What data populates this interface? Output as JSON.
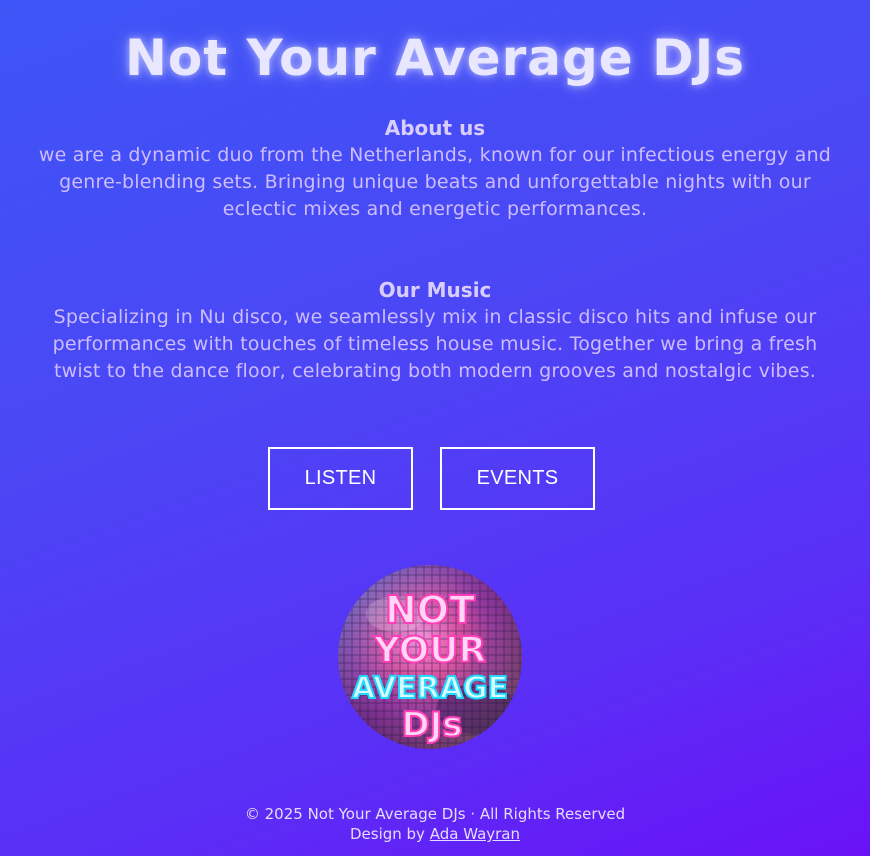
{
  "header": {
    "title": "Not Your Average DJs"
  },
  "about": {
    "heading": "About us",
    "text": "we are a dynamic duo from the Netherlands, known for our infectious energy and genre-blending sets. Bringing unique beats and unforgettable nights with our eclectic mixes and energetic performances."
  },
  "music": {
    "heading": "Our Music",
    "text": "Specializing in Nu disco, we seamlessly mix in classic disco hits and infuse our performances with touches of timeless house music. Together we bring a fresh twist to the dance floor, celebrating both modern grooves and nostalgic vibes."
  },
  "buttons": {
    "listen": "LISTEN",
    "events": "EVENTS"
  },
  "logo": {
    "line1": "NOT",
    "line2": "YOUR",
    "line3": "AVERAGE",
    "line4": "DJs",
    "icon": "disco-ball-logo"
  },
  "footer": {
    "copyright": "© 2025 Not Your Average DJs · All Rights Reserved",
    "design_prefix": "Design by",
    "designer": "Ada Wayran"
  },
  "colors": {
    "bg_start": "#3d55f6",
    "bg_end": "#6a12f7",
    "text": "#cdbcff",
    "neon_pink": "#ff4fc8",
    "neon_cyan": "#34e7ff"
  }
}
